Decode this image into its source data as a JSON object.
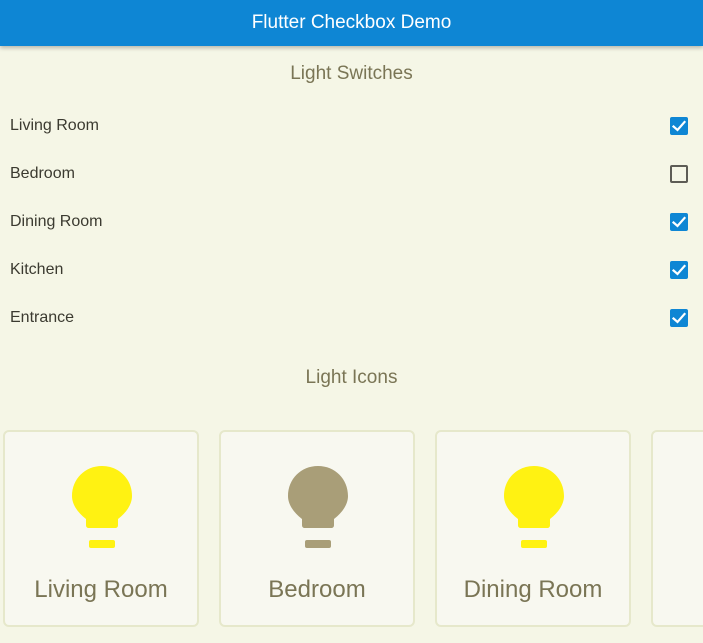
{
  "appbar": {
    "title": "Flutter Checkbox Demo"
  },
  "switches_section": {
    "title": "Light Switches",
    "items": [
      {
        "label": "Living Room",
        "checked": true
      },
      {
        "label": "Bedroom",
        "checked": false
      },
      {
        "label": "Dining Room",
        "checked": true
      },
      {
        "label": "Kitchen",
        "checked": true
      },
      {
        "label": "Entrance",
        "checked": true
      }
    ]
  },
  "icons_section": {
    "title": "Light Icons",
    "cards": [
      {
        "label": "Living Room",
        "icon": "lightbulb-icon",
        "on": true
      },
      {
        "label": "Bedroom",
        "icon": "lightbulb-icon",
        "on": false
      },
      {
        "label": "Dining Room",
        "icon": "lightbulb-icon",
        "on": true
      },
      {
        "label": "",
        "icon": "",
        "on": true
      }
    ]
  },
  "colors": {
    "primary": "#0e86d4",
    "background": "#f5f6e6",
    "bulb_on": "#fff212",
    "bulb_off": "#a99e78",
    "text_muted": "#7a7555"
  }
}
